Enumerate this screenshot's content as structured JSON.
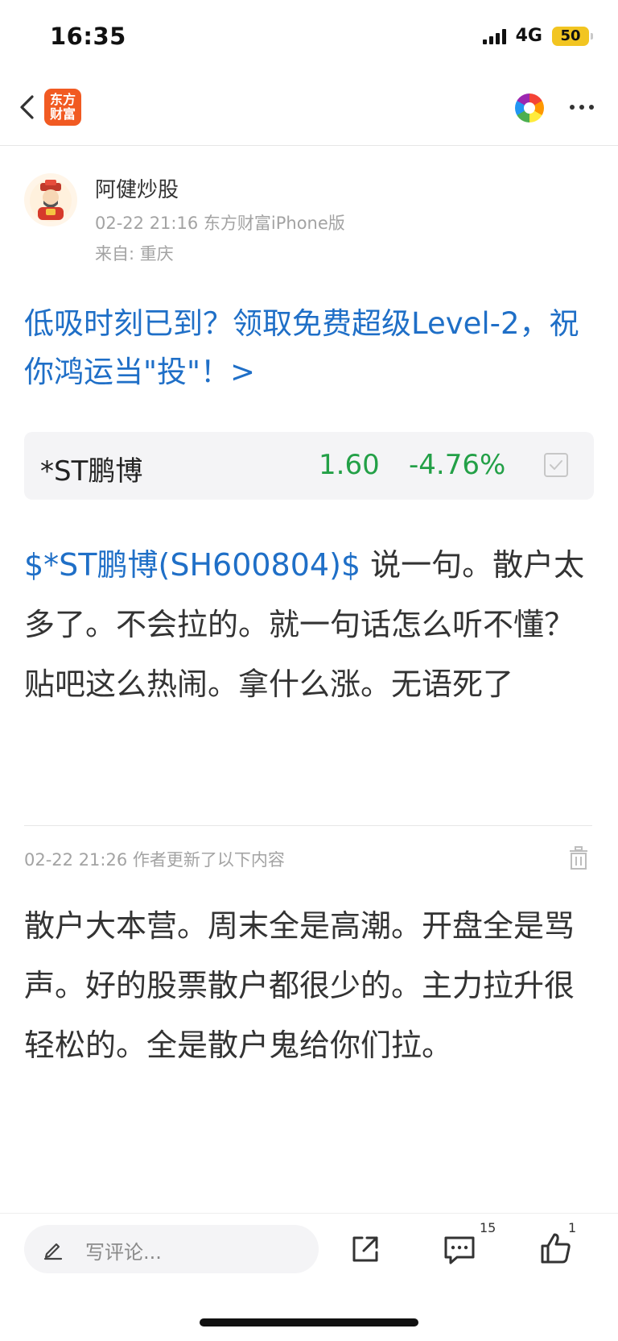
{
  "status_bar": {
    "time": "16:35",
    "network": "4G",
    "battery": "50"
  },
  "nav": {
    "back_icon": "chevron-left-icon",
    "app_logo_line1": "东方",
    "app_logo_line2": "财富",
    "brand_color": "#f15a22",
    "color_wheel_icon": "color-wheel-icon",
    "more_icon": "more-dots-icon"
  },
  "author": {
    "name": "阿健炒股",
    "meta": "02-22 21:16 东方财富iPhone版",
    "location": "来自: 重庆"
  },
  "promo": {
    "text": "低吸时刻已到？领取免费超级Level-2，祝你鸿运当\"投\"！>",
    "color": "#1f6fc7"
  },
  "stock": {
    "name": "*ST鹏博",
    "price": "1.60",
    "change": "-4.76%",
    "color": "#23a047"
  },
  "post": {
    "stock_tag": "$*ST鹏博(SH600804)$",
    "text": " 说一句。散户太多了。不会拉的。就一句话怎么听不懂？贴吧这么热闹。拿什么涨。无语死了"
  },
  "update": {
    "header": "02-22 21:26  作者更新了以下内容",
    "text": "散户大本营。周末全是高潮。开盘全是骂声。好的股票散户都很少的。主力拉升很轻松的。全是散户鬼给你们拉。"
  },
  "bottom_bar": {
    "comment_placeholder": "写评论...",
    "comment_count": "15",
    "like_count": "1"
  }
}
